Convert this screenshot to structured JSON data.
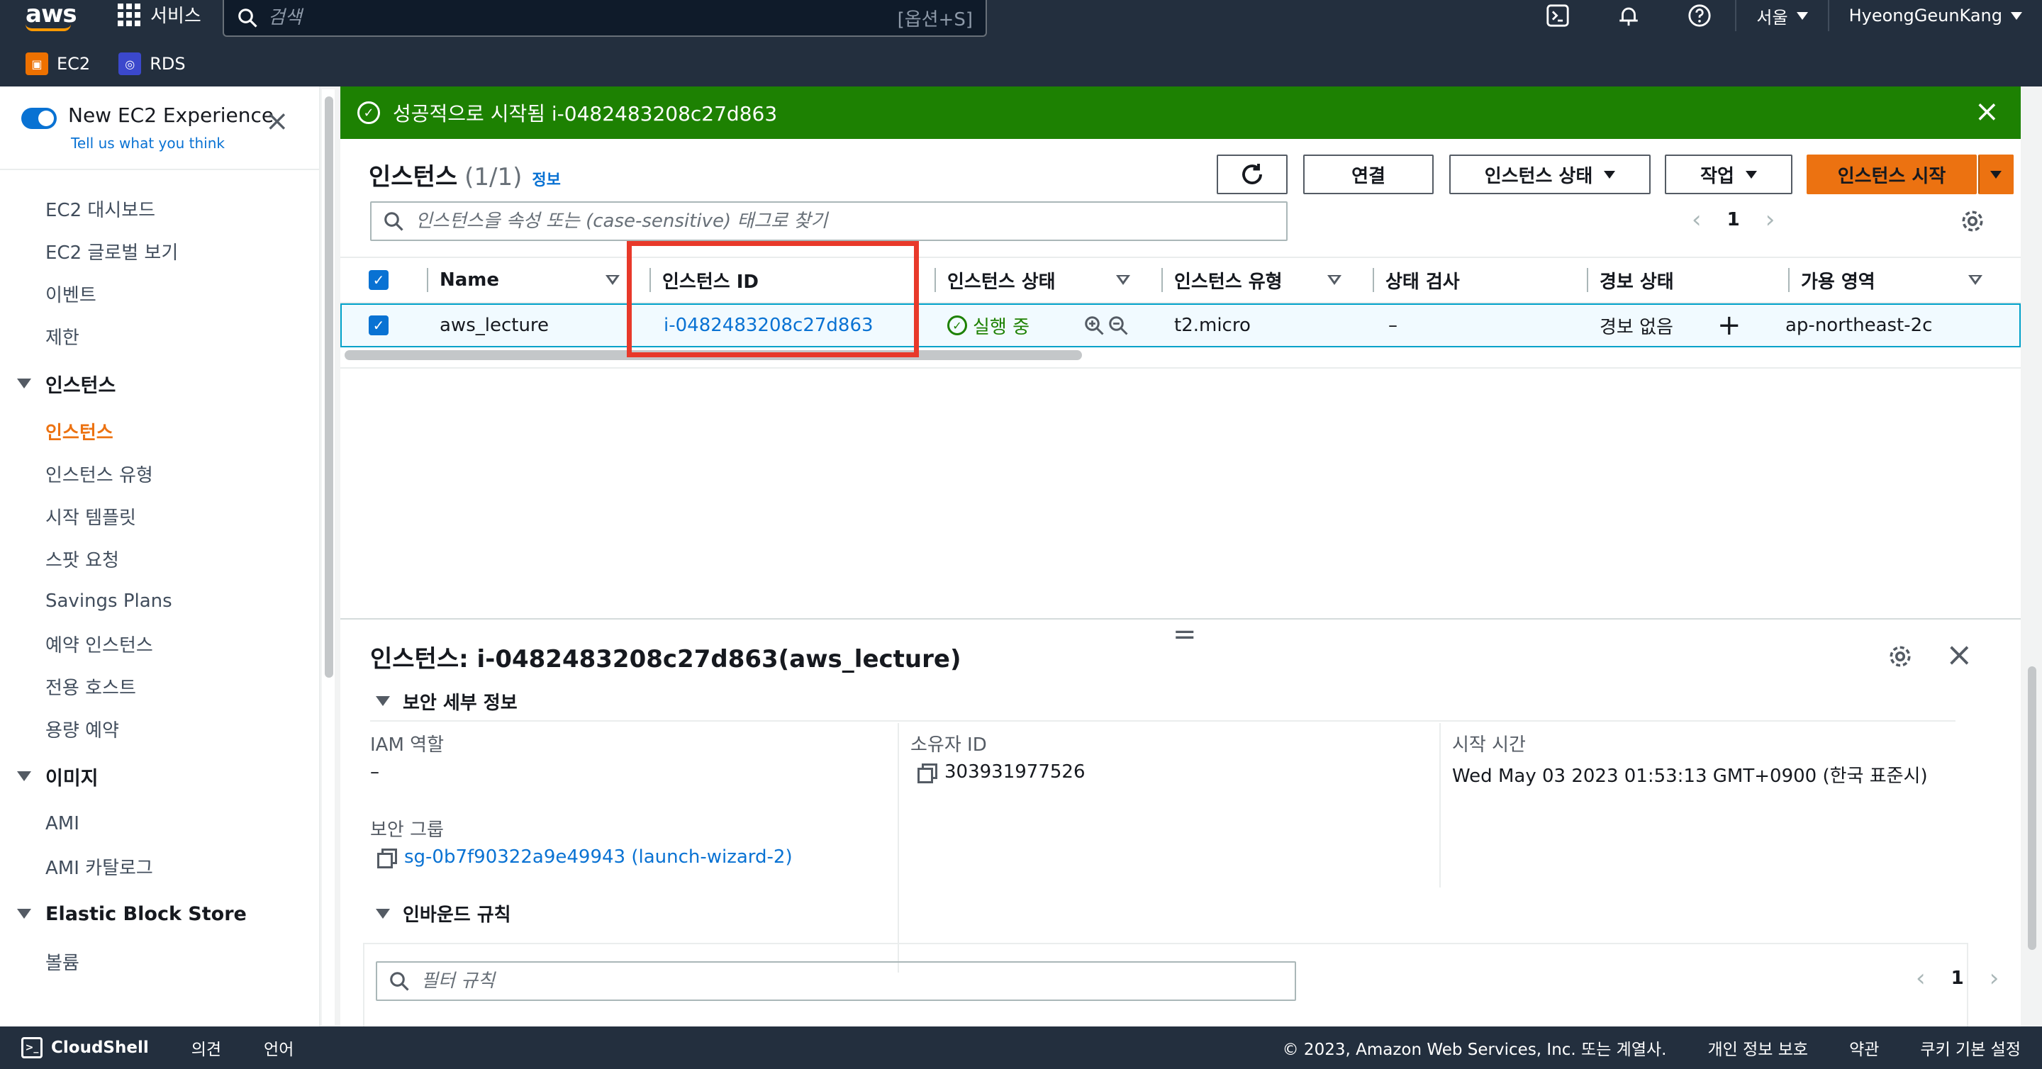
{
  "topnav": {
    "logo": "aws",
    "services_label": "서비스",
    "search_placeholder": "검색",
    "search_shortcut": "[옵션+S]",
    "region": "서울",
    "user": "HyeongGeunKang"
  },
  "favorites": [
    {
      "label": "EC2",
      "color": "#ed7100"
    },
    {
      "label": "RDS",
      "color": "#3b48cc"
    }
  ],
  "sidebar": {
    "experience_title": "New EC2 Experience",
    "experience_link": "Tell us what you think",
    "items_top": [
      "EC2 대시보드",
      "EC2 글로벌 보기",
      "이벤트",
      "제한"
    ],
    "section_instances": "인스턴스",
    "items_instances": [
      "인스턴스",
      "인스턴스 유형",
      "시작 템플릿",
      "스팟 요청",
      "Savings Plans",
      "예약 인스턴스",
      "전용 호스트",
      "용량 예약"
    ],
    "section_images": "이미지",
    "items_images": [
      "AMI",
      "AMI 카탈로그"
    ],
    "section_ebs": "Elastic Block Store",
    "items_ebs": [
      "볼륨"
    ]
  },
  "flash": {
    "message": "성공적으로 시작됨 i-0482483208c27d863"
  },
  "instances": {
    "title": "인스턴스",
    "count": "(1/1)",
    "info_link": "정보",
    "btn_connect": "연결",
    "btn_state": "인스턴스 상태",
    "btn_actions": "작업",
    "btn_launch": "인스턴스 시작",
    "filter_placeholder": "인스턴스을 속성 또는 (case-sensitive) 태그로 찾기",
    "page": "1",
    "columns": [
      "Name",
      "인스턴스 ID",
      "인스턴스 상태",
      "인스턴스 유형",
      "상태 검사",
      "경보 상태",
      "가용 영역"
    ],
    "row": {
      "name": "aws_lecture",
      "id": "i-0482483208c27d863",
      "state": "실행 중",
      "type": "t2.micro",
      "status_check": "–",
      "alarm": "경보 없음",
      "az": "ap-northeast-2c"
    }
  },
  "detail": {
    "title": "인스턴스: i-0482483208c27d863(aws_lecture)",
    "security_section": "보안 세부 정보",
    "iam_label": "IAM 역할",
    "iam_value": "–",
    "owner_label": "소유자 ID",
    "owner_value": "303931977526",
    "launch_label": "시작 시간",
    "launch_value": "Wed May 03 2023 01:53:13 GMT+0900 (한국 표준시)",
    "sg_label": "보안 그룹",
    "sg_value": "sg-0b7f90322a9e49943 (launch-wizard-2)",
    "inbound_section": "인바운드 규칙",
    "rule_filter_placeholder": "필터 규칙",
    "page": "1"
  },
  "footer": {
    "cloudshell": "CloudShell",
    "feedback": "의견",
    "language": "언어",
    "copyright": "© 2023, Amazon Web Services, Inc. 또는 계열사.",
    "privacy": "개인 정보 보호",
    "terms": "약관",
    "cookies": "쿠키 기본 설정"
  },
  "colors": {
    "nav_bg": "#232f3e",
    "accent_orange": "#ec7211",
    "link_blue": "#0972d3",
    "success_green": "#1d8102",
    "highlight_red": "#e8392a"
  }
}
